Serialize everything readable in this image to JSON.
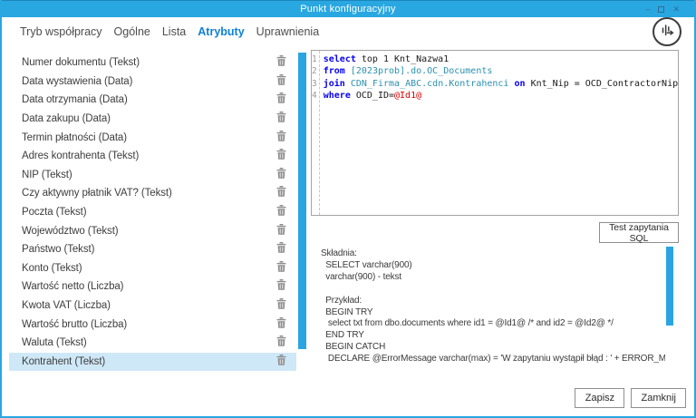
{
  "window": {
    "title": "Punkt konfiguracyjny",
    "controls": {
      "minimize": "–",
      "close": "✕"
    }
  },
  "tabs": [
    {
      "label": "Tryb współpracy",
      "active": false
    },
    {
      "label": "Ogólne",
      "active": false
    },
    {
      "label": "Lista",
      "active": false
    },
    {
      "label": "Atrybuty",
      "active": true
    },
    {
      "label": "Uprawnienia",
      "active": false
    }
  ],
  "attributes": {
    "selected_index": 16,
    "items": [
      "Numer dokumentu (Tekst)",
      "Data wystawienia (Data)",
      "Data otrzymania (Data)",
      "Data zakupu (Data)",
      "Termin płatności (Data)",
      "Adres kontrahenta (Tekst)",
      "NIP (Tekst)",
      "Czy aktywny płatnik VAT? (Tekst)",
      "Poczta (Tekst)",
      "Województwo (Tekst)",
      "Państwo (Tekst)",
      "Konto (Tekst)",
      "Wartość netto (Liczba)",
      "Kwota VAT (Liczba)",
      "Wartość brutto (Liczba)",
      "Waluta (Tekst)",
      "Kontrahent (Tekst)"
    ]
  },
  "sql_editor": {
    "lines": [
      [
        [
          "kw",
          "select"
        ],
        [
          "pl",
          " top 1 Knt_Nazwa1"
        ]
      ],
      [
        [
          "kw",
          "from"
        ],
        [
          "pl",
          " "
        ],
        [
          "obj",
          "[2023prob].do.OC_Documents"
        ]
      ],
      [
        [
          "kw",
          "join"
        ],
        [
          "pl",
          " "
        ],
        [
          "obj",
          "CDN_Firma_ABC.cdn.Kontrahenci"
        ],
        [
          "pl",
          " "
        ],
        [
          "kw",
          "on"
        ],
        [
          "pl",
          " Knt_Nip = OCD_ContractorNip"
        ]
      ],
      [
        [
          "kw",
          "where"
        ],
        [
          "pl",
          " OCD_ID="
        ],
        [
          "param",
          "@Id1@"
        ]
      ]
    ]
  },
  "test_button_label": "Test zapytania SQL",
  "help": {
    "lines": [
      "Składnia:",
      "  SELECT varchar(900)",
      "  varchar(900) - tekst",
      "",
      "  Przykład:",
      "  BEGIN TRY",
      "   select txt from dbo.documents where id1 = @Id1@ /* and id2 = @Id2@ */",
      "  END TRY",
      "  BEGIN CATCH",
      "   DECLARE @ErrorMessage varchar(max) = 'W zapytaniu wystąpił błąd : ' + ERROR_MESSAGE();"
    ]
  },
  "footer": {
    "save_label": "Zapisz",
    "close_label": "Zamknij"
  },
  "colors": {
    "titlebar": "#29a7e1",
    "active_tab": "#0f7fd5",
    "scrollbar": "#2ba4e2",
    "selected_row": "#cfe8f8",
    "sql_keyword": "#0600f5",
    "sql_object": "#2b91af",
    "sql_parameter": "#e00000"
  }
}
